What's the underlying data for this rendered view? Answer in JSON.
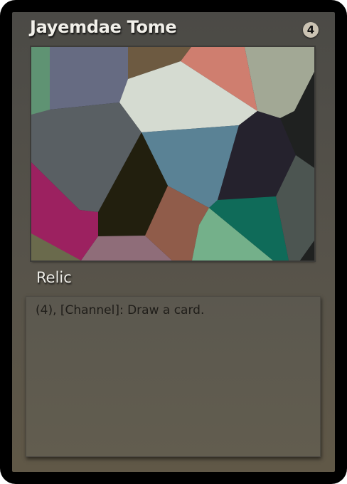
{
  "card": {
    "name": "Jayemdae Tome",
    "cost": "4",
    "type_line": "Relic",
    "rules_text": "(4), [Channel]: Draw a card."
  },
  "art": {
    "colors": {
      "green": "#5f9373",
      "slate_blue": "#666b82",
      "brown": "#6d5a41",
      "salmon": "#cf7e6f",
      "sage": "#a2a895",
      "off_white": "#d5dbd1",
      "charcoal": "#1f2120",
      "gray": "#595f63",
      "steel_blue": "#5a8295",
      "dark_navy": "#25222d",
      "dark_olive": "#221f0e",
      "magenta": "#9c2160",
      "terracotta": "#905c4a",
      "mint": "#74b08a",
      "teal": "#0f6b59",
      "dark_slate": "#4c5551",
      "olive": "#6a6a4c",
      "mauve": "#8f6d79"
    }
  }
}
